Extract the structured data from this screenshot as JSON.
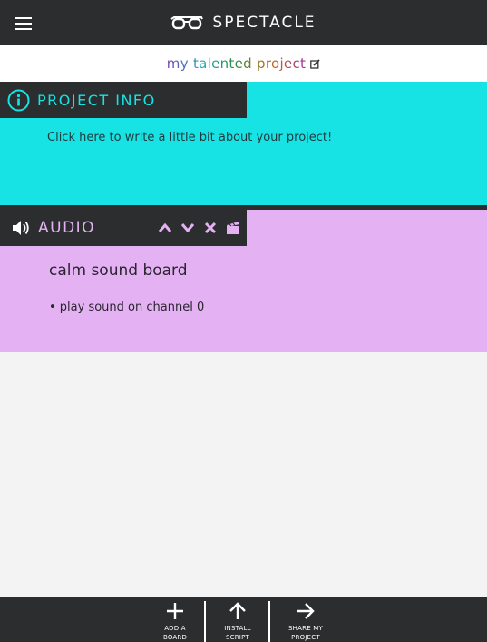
{
  "header": {
    "brand": "SPECTACLE",
    "menu_icon": "hamburger-icon",
    "logo_icon": "glasses-icon"
  },
  "project": {
    "title": "my talented project",
    "edit_icon": "edit-icon"
  },
  "info_board": {
    "label": "PROJECT INFO",
    "icon": "info-icon",
    "description_placeholder": "Click here to write a little bit about your project!",
    "color": "#18e3e4"
  },
  "audio_board": {
    "label": "AUDIO",
    "icon": "speaker-icon",
    "tools": [
      "chevron-up-icon",
      "chevron-down-icon",
      "close-icon",
      "clapperboard-icon"
    ],
    "board_name": "calm sound board",
    "commands": [
      "• play sound on channel 0"
    ],
    "color": "#e4b2f3"
  },
  "footer": {
    "add_board": {
      "line1": "ADD A",
      "line2": "BOARD",
      "icon": "plus-icon"
    },
    "install_script": {
      "line1": "INSTALL",
      "line2": "SCRIPT",
      "icon": "arrow-up-icon"
    },
    "share_project": {
      "line1": "SHARE MY",
      "line2": "PROJECT",
      "icon": "arrow-right-icon"
    }
  },
  "colors": {
    "dark": "#2b2d2e",
    "background": "#f3f3f3"
  }
}
